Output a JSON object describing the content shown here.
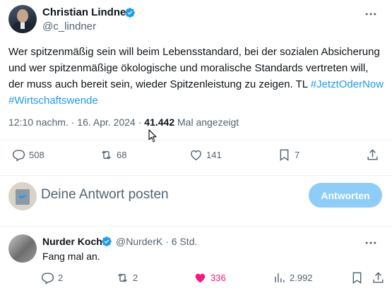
{
  "tweet": {
    "author_name": "Christian Lindner",
    "author_handle": "@c_lindner",
    "text_parts": [
      "Wer spitzenmäßig sein will beim Lebensstandard, bei der sozialen Absicherung und wer spitzenmäßige ökologische und moralische Standards vertreten will, der muss auch bereit sein, wieder Spitzenleistung zu zeigen. TL ",
      "#JetztOderNow",
      " ",
      "#Wirtschaftswende"
    ],
    "time": "12:10 nachm.",
    "date": "16. Apr. 2024",
    "views_count": "41.442",
    "views_label": "Mal angezeigt",
    "actions": {
      "replies": "508",
      "reposts": "68",
      "likes": "141",
      "bookmarks": "7"
    }
  },
  "reply_box": {
    "placeholder": "Deine Antwort posten",
    "button_label": "Antworten"
  },
  "reply": {
    "author_name": "Nurder Koch",
    "author_handle": "@NurderK",
    "age": "6 Std.",
    "text": "Fang mal an.",
    "actions": {
      "replies": "2",
      "reposts": "2",
      "likes": "336",
      "views": "2.992"
    }
  },
  "colors": {
    "accent": "#1d9bf0",
    "like_active": "#f91880",
    "button_disabled": "#8ecdf7",
    "secondary_text": "#536471"
  },
  "icons": [
    "verified-icon",
    "more-icon",
    "reply-icon",
    "repost-icon",
    "like-icon",
    "bookmark-icon",
    "share-icon",
    "views-icon"
  ]
}
